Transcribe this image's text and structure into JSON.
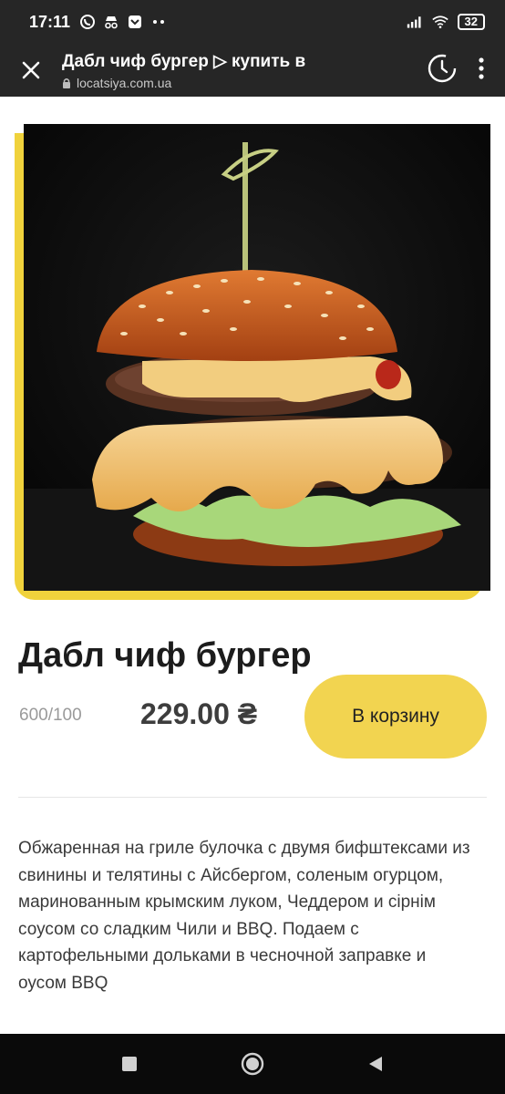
{
  "status_bar": {
    "time": "17:11",
    "battery": "32",
    "left_icons": [
      "viber-icon",
      "incognito-icon",
      "pocket-icon",
      "more-dots-icon"
    ],
    "right_icons": [
      "signal-icon",
      "wifi-icon",
      "battery-icon"
    ]
  },
  "toolbar": {
    "title": "Дабл чиф бургер ▷ купить в",
    "url": "locatsiya.com.ua",
    "icons": [
      "close-icon",
      "lock-icon",
      "history-icon",
      "kebab-menu-icon"
    ]
  },
  "product": {
    "title": "Дабл чиф бургер",
    "weight": "600/100",
    "price": "229.00 ₴",
    "cart_label": "В корзину",
    "description": "Обжаренная на гриле булочка с двумя бифштексами из свинины и телятины с Айсбергом, соленым огурцом,  маринованным крымским луком, Чеддером и сірнім соусом со сладким Чили и BBQ. Подаем с картофельными дольками в чесночной заправке и оусом BBQ"
  },
  "colors": {
    "accent": "#f2d450",
    "frame": "#f0d23c",
    "bars": "#262626"
  },
  "nav": {
    "icons": [
      "recent-apps-icon",
      "home-icon",
      "back-icon"
    ]
  }
}
